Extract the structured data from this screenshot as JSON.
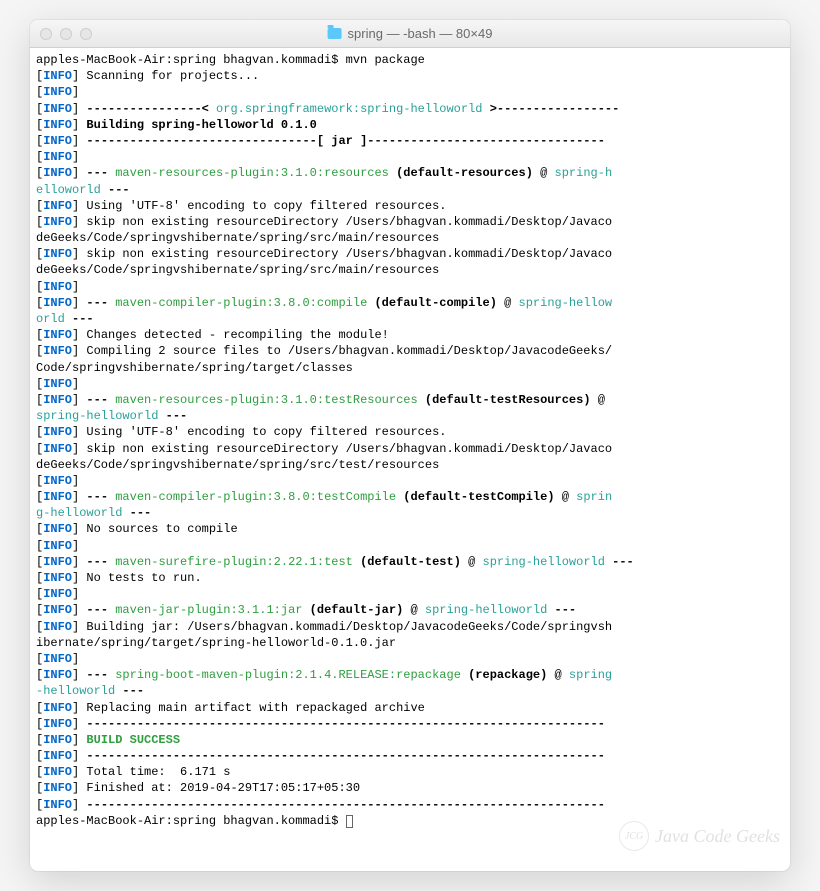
{
  "window": {
    "title": "spring — -bash — 80×49"
  },
  "prompt": {
    "line1": "apples-MacBook-Air:spring bhagvan.kommadi$ mvn package",
    "line2": "apples-MacBook-Air:spring bhagvan.kommadi$ "
  },
  "tags": {
    "info": "INFO"
  },
  "lines": {
    "scan": " Scanning for projects...",
    "dash1_pre": " ----------------< ",
    "artifact": "org.springframework:spring-helloworld",
    "dash1_post": " >-----------------",
    "building": " Building spring-helloworld 0.1.0",
    "jar_rule": " --------------------------------[ jar ]---------------------------------",
    "res_plugin_pre": " --- ",
    "res_plugin": "maven-resources-plugin:3.1.0:resources",
    "res_plugin_goal": " (default-resources)",
    "res_plugin_at": " @ ",
    "project": "spring-helloworld",
    "tail_dash": " ---",
    "proj_break1": "spring-h",
    "proj_break1b": "elloworld",
    "utf8": " Using 'UTF-8' encoding to copy filtered resources.",
    "skip1a": " skip non existing resourceDirectory /Users/bhagvan.kommadi/Desktop/Javaco",
    "skip1b": "deGeeks/Code/springvshibernate/spring/src/main/resources",
    "compile_plugin": "maven-compiler-plugin:3.8.0:compile",
    "compile_goal": " (default-compile)",
    "proj_break2": "spring-hellow",
    "proj_break2b": "orld",
    "changes": " Changes detected - recompiling the module!",
    "compile2a": " Compiling 2 source files to /Users/bhagvan.kommadi/Desktop/JavacodeGeeks/",
    "compile2b": "Code/springvshibernate/spring/target/classes",
    "testres_plugin": "maven-resources-plugin:3.1.0:testResources",
    "testres_goal": " (default-testResources)",
    "testres_at": " @ ",
    "skip2a": " skip non existing resourceDirectory /Users/bhagvan.kommadi/Desktop/Javaco",
    "skip2b": "deGeeks/Code/springvshibernate/spring/src/test/resources",
    "testcompile_plugin": "maven-compiler-plugin:3.8.0:testCompile",
    "testcompile_goal": " (default-testCompile)",
    "proj_break3": "sprin",
    "proj_break3b": "g-helloworld",
    "nosrc": " No sources to compile",
    "surefire_plugin": "maven-surefire-plugin:2.22.1:test",
    "surefire_goal": " (default-test)",
    "notests": " No tests to run.",
    "jar_plugin": "maven-jar-plugin:3.1.1:jar",
    "jar_goal": " (default-jar)",
    "buildjar_a": " Building jar: /Users/bhagvan.kommadi/Desktop/JavacodeGeeks/Code/springvsh",
    "buildjar_b": "ibernate/spring/target/spring-helloworld-0.1.0.jar",
    "boot_plugin": "spring-boot-maven-plugin:2.1.4.RELEASE:repackage",
    "boot_goal": " (repackage)",
    "proj_break4": "spring",
    "proj_break4b": "-helloworld",
    "replacing": " Replacing main artifact with repackaged archive",
    "rule": " ------------------------------------------------------------------------",
    "success": " BUILD SUCCESS",
    "total": " Total time:  6.171 s",
    "finished": " Finished at: 2019-04-29T17:05:17+05:30"
  },
  "watermark": {
    "text": "Java Code Geeks",
    "badge": "JCG"
  }
}
